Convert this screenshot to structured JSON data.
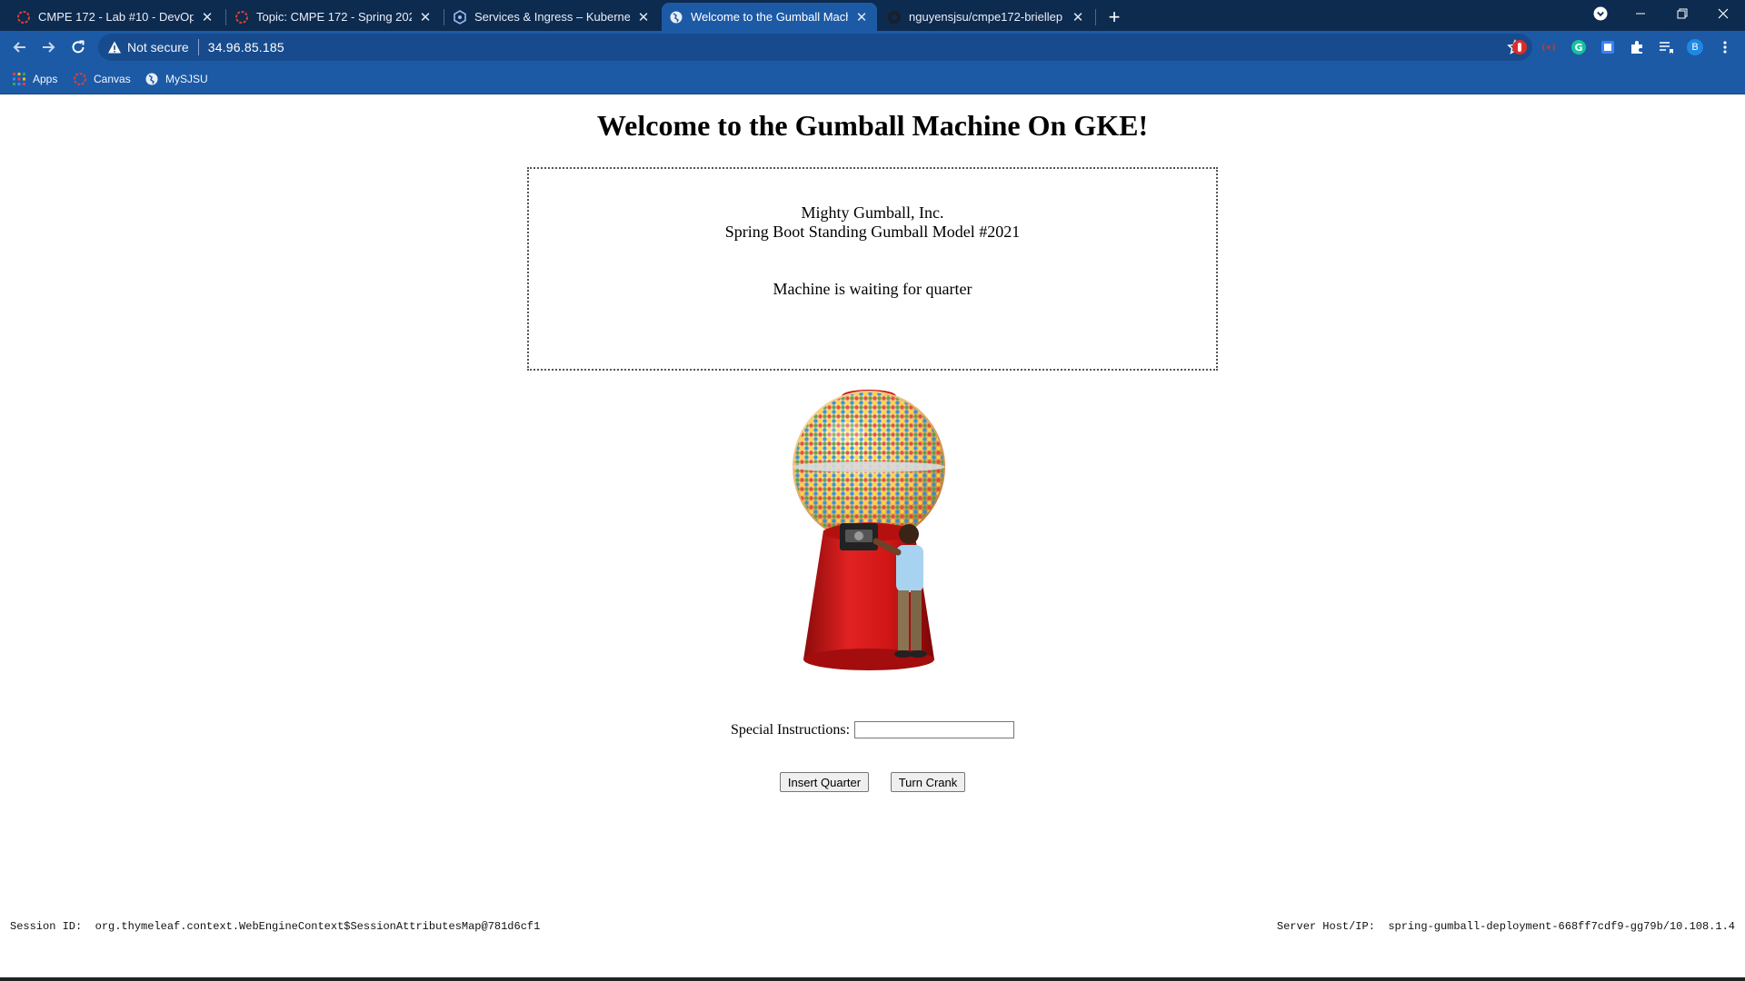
{
  "browser": {
    "tabs": [
      {
        "title": "CMPE 172 - Lab #10 - DevOps CI",
        "icon": "canvas-icon"
      },
      {
        "title": "Topic: CMPE 172 - Spring 2021 -",
        "icon": "canvas-icon"
      },
      {
        "title": "Services & Ingress – Kubernetes",
        "icon": "kubernetes-icon"
      },
      {
        "title": "Welcome to the Gumball Machin",
        "icon": "globe-icon",
        "active": true
      },
      {
        "title": "nguyensjsu/cmpe172-briellep",
        "icon": "github-icon"
      }
    ],
    "address_bar": {
      "security_label": "Not secure",
      "url": "34.96.85.185"
    },
    "profile_initial": "B",
    "bookmarks": [
      {
        "label": "Apps",
        "icon": "apps-grid-icon"
      },
      {
        "label": "Canvas",
        "icon": "canvas-icon"
      },
      {
        "label": "MySJSU",
        "icon": "globe-icon"
      }
    ],
    "colors": {
      "tabstrip": "#0d2a4f",
      "toolbar": "#1c5aa6",
      "active_tab": "#1c5aa6"
    }
  },
  "page": {
    "title": "Welcome to the Gumball Machine On GKE!",
    "company": "Mighty Gumball, Inc.",
    "model": "Spring Boot Standing Gumball Model #2021",
    "state": "Machine is waiting for quarter",
    "image": "gumball-machine-image",
    "instructions_label": "Special Instructions:",
    "instructions_value": "",
    "buttons": {
      "insert_quarter": "Insert Quarter",
      "turn_crank": "Turn Crank"
    }
  },
  "footer": {
    "session_label": "Session ID:",
    "session_value": "org.thymeleaf.context.WebEngineContext$SessionAttributesMap@781d6cf1",
    "server_label": "Server Host/IP:",
    "server_value": "spring-gumball-deployment-668ff7cdf9-gg79b/10.108.1.4"
  }
}
